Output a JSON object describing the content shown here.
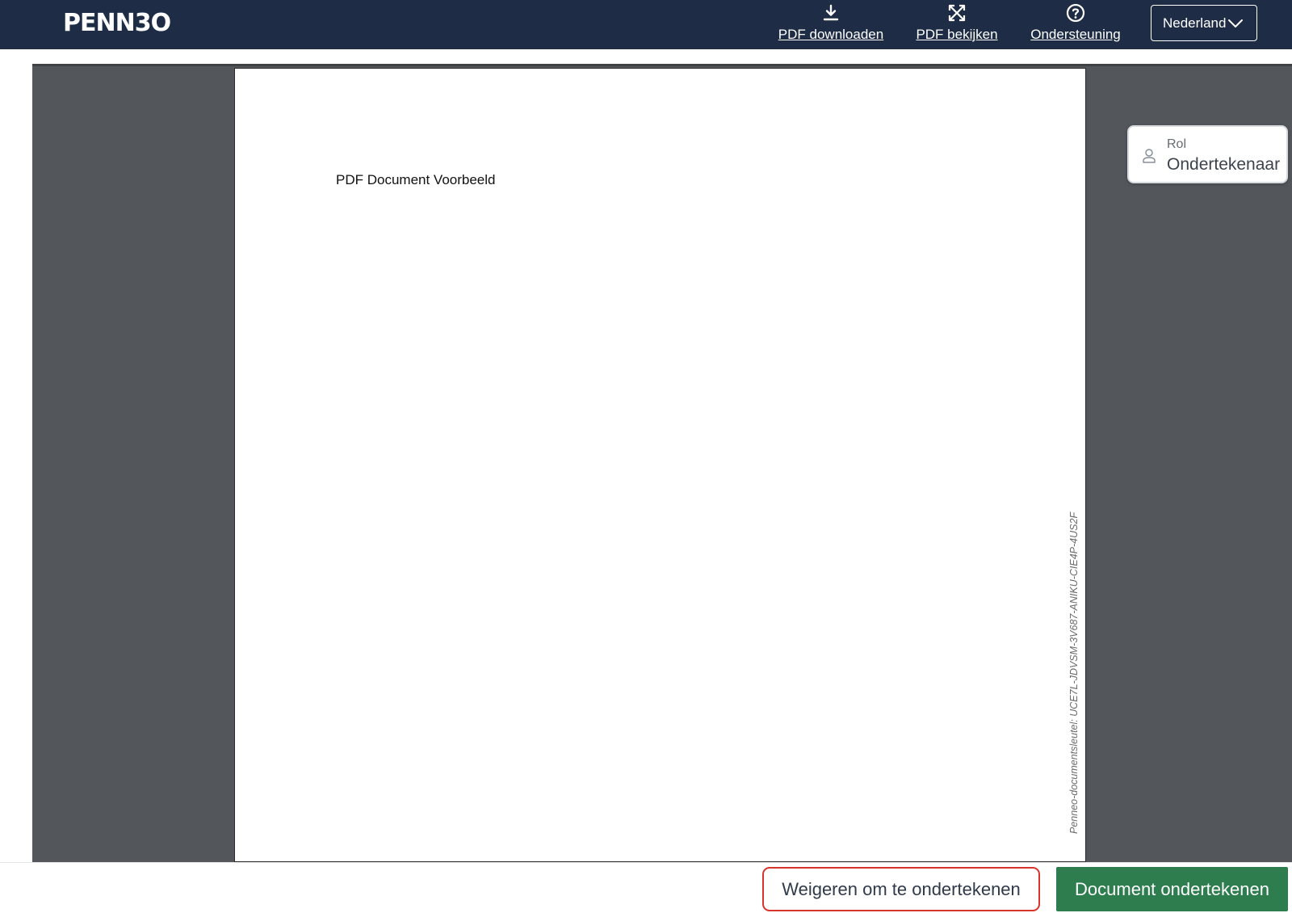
{
  "app": {
    "logo_text": "PENN3O"
  },
  "header": {
    "links": {
      "download": {
        "label": "PDF downloaden",
        "icon": "download-icon"
      },
      "view": {
        "label": "PDF bekijken",
        "icon": "expand-icon"
      },
      "support": {
        "label": "Ondersteuning",
        "icon": "help-icon"
      }
    },
    "language": {
      "selected": "Nederland",
      "icon": "chevron-down-icon"
    }
  },
  "document": {
    "title": "PDF Document Voorbeeld",
    "document_key": "Penneo-documentsleutel: UCE7L-JDVSM-3V687-ANIKU-CIE4P-4US2F"
  },
  "role": {
    "label": "Rol",
    "value": "Ondertekenaar",
    "icon": "user-icon"
  },
  "footer": {
    "decline_label": "Weigeren om te ondertekenen",
    "sign_label": "Document ondertekenen"
  },
  "colors": {
    "header_bg": "#1e2d45",
    "viewer_bg": "#53575b",
    "sign_button": "#2e7d4f",
    "decline_border": "#d9342b"
  }
}
